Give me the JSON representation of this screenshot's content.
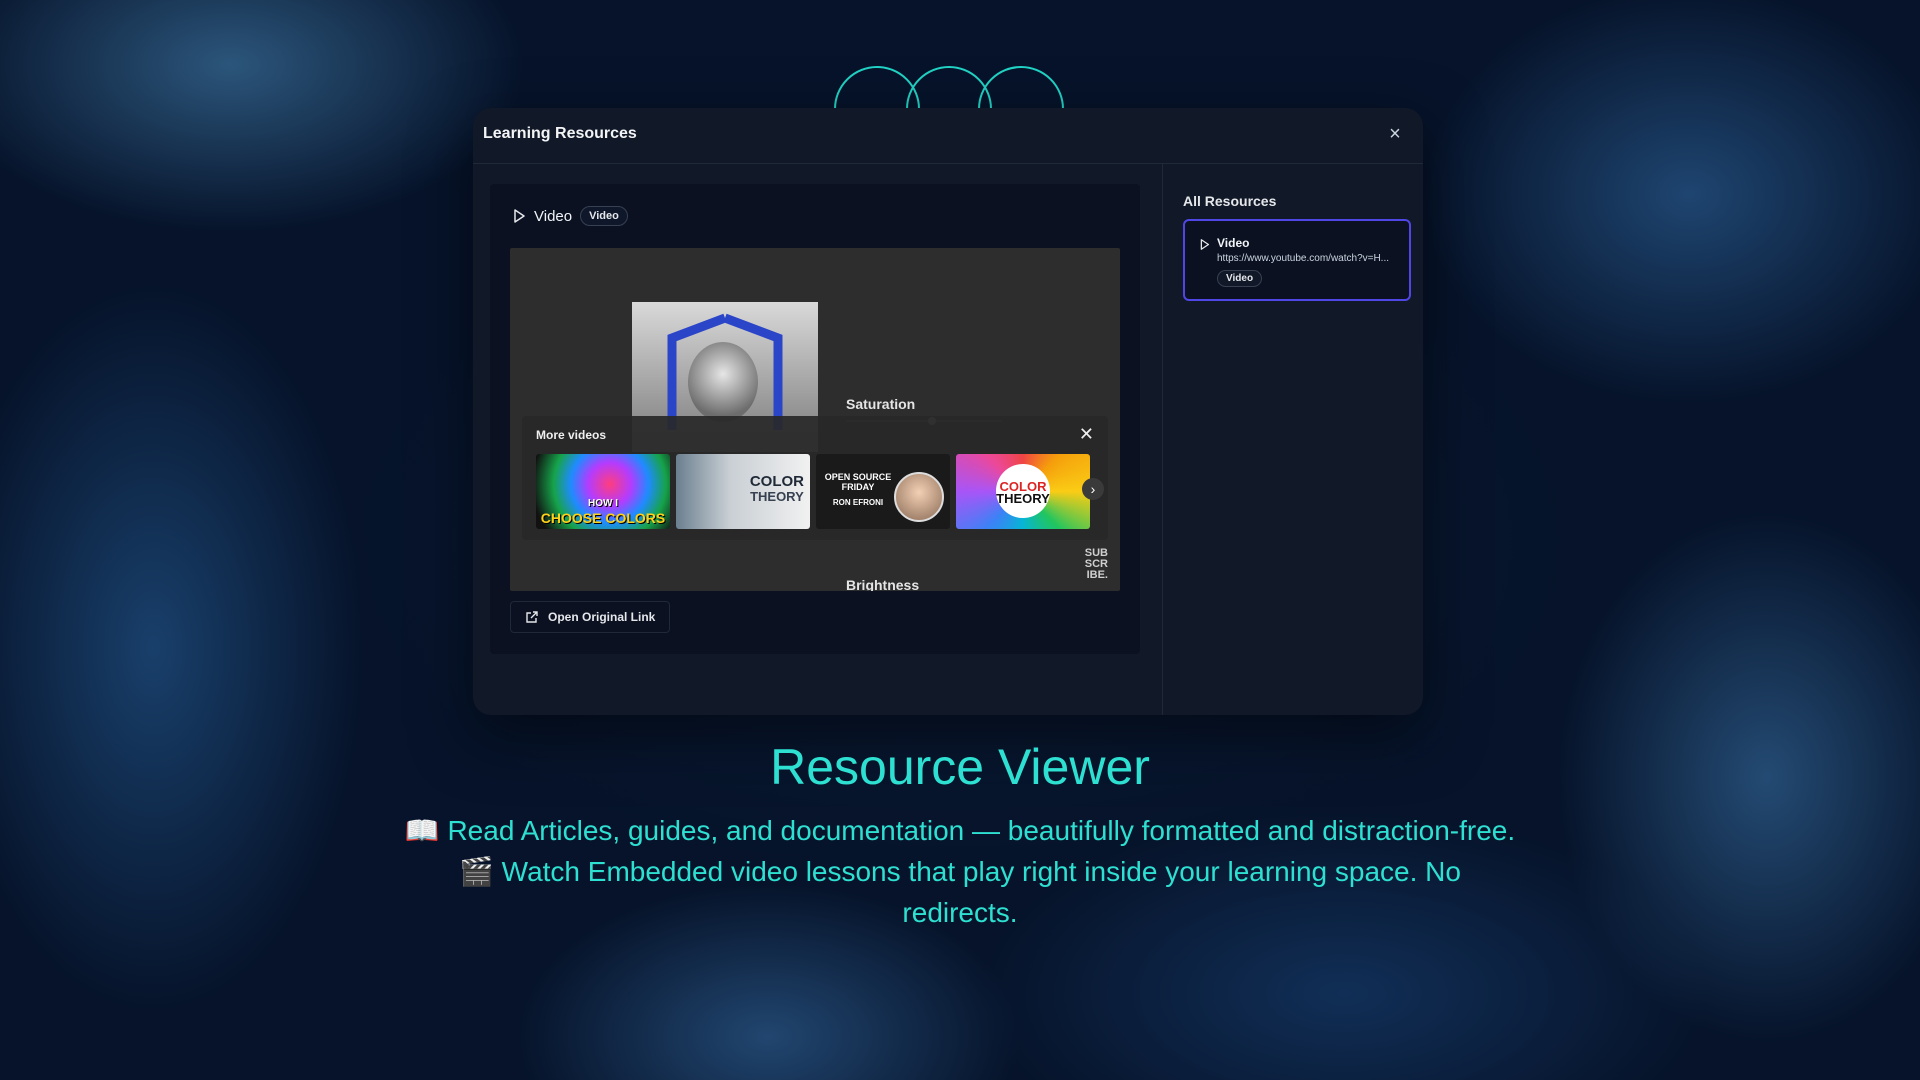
{
  "dialog": {
    "title": "Learning Resources",
    "close_label": "×"
  },
  "video": {
    "title": "Video",
    "badge": "Video"
  },
  "player": {
    "saturation_label": "Saturation",
    "brightness_label": "Brightness",
    "subscribe_text": "SUB SCR IBE.",
    "more_videos": {
      "title": "More videos",
      "close_label": "✕",
      "next_label": "›",
      "thumbnails": [
        {
          "caption_top": "HOW I",
          "caption": "CHOOSE COLORS"
        },
        {
          "caption": "COLOR",
          "caption_sub": "THEORY"
        },
        {
          "caption": "OPEN SOURCE FRIDAY",
          "caption_sub": "RON EFRONI"
        },
        {
          "caption": "COLOR",
          "caption_sub": "THEORY"
        }
      ]
    }
  },
  "open_link": {
    "label": "Open Original Link"
  },
  "sidebar": {
    "title": "All Resources",
    "resource": {
      "name": "Video",
      "url": "https://www.youtube.com/watch?v=H...",
      "badge": "Video"
    }
  },
  "caption": {
    "title": "Resource Viewer",
    "line1": "📖 Read Articles, guides, and documentation — beautifully formatted and distraction-free.",
    "line2": "🎬 Watch Embedded video lessons that play right inside your learning space. No redirects."
  },
  "colors": {
    "accent": "#2ee0d1",
    "selected_border": "#4f46e5",
    "panel_bg": "#111827"
  }
}
